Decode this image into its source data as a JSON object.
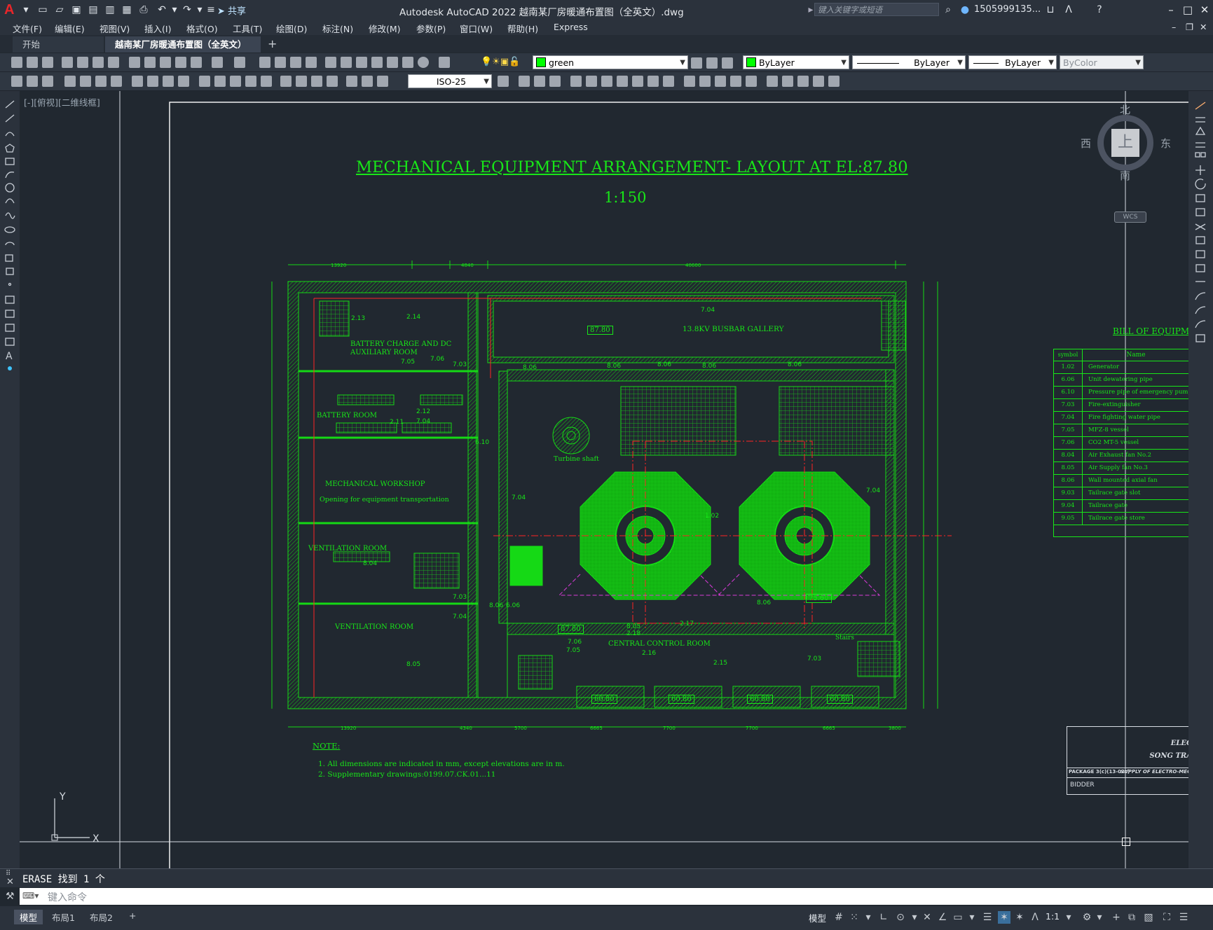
{
  "titlebar": {
    "app_logo": "A",
    "share": "共享",
    "title": "Autodesk AutoCAD 2022    越南某厂房暖通布置图（全英文）.dwg",
    "search_placeholder": "键入关键字或短语",
    "user": "1505999135..."
  },
  "menu": [
    "文件(F)",
    "编辑(E)",
    "视图(V)",
    "插入(I)",
    "格式(O)",
    "工具(T)",
    "绘图(D)",
    "标注(N)",
    "修改(M)",
    "参数(P)",
    "窗口(W)",
    "帮助(H)",
    "Express"
  ],
  "tabs": {
    "start": "开始",
    "drawing": "越南某厂房暖通布置图（全英文）*"
  },
  "toolbar": {
    "layer_name": "green",
    "color": "ByLayer",
    "linetype": "ByLayer",
    "lineweight": "ByLayer",
    "plotstyle": "ByColor",
    "dimstyle": "ISO-25",
    "layer_color": "#00ff00"
  },
  "viewport_label": "[-][俯视][二维线框]",
  "viewcube": {
    "north": "北",
    "south": "南",
    "east": "东",
    "west": "西",
    "top": "上",
    "wcs": "WCS"
  },
  "drawing": {
    "title": "MECHANICAL EQUIPMENT ARRANGEMENT- LAYOUT AT EL:87.80",
    "scale": "1:150",
    "rooms": {
      "busbar": "13.8KV BUSBAR GALLERY",
      "battery_charge": "BATTERY CHARGE AND DC",
      "aux_room": "AUXILIARY ROOM",
      "battery_room": "BATTERY ROOM",
      "workshop": "MECHANICAL WORKSHOP",
      "opening": "Opening for equipment transportation",
      "vent1": "VENTILATION ROOM",
      "vent2": "VENTILATION ROOM",
      "control": "CENTRAL CONTROL ROOM",
      "turbine": "Turbine shaft",
      "stairs": "Stairs"
    },
    "elevations": [
      "87.80",
      "87.80",
      "75.60",
      "60.80",
      "60.80",
      "60.80",
      "60.80"
    ],
    "dims_top": [
      "13920",
      "4840",
      "40600"
    ],
    "dims_bottom": [
      "13920",
      "4340",
      "5700",
      "6665",
      "7700",
      "7700",
      "6665",
      "3800"
    ],
    "labels": [
      "2.13",
      "2.14",
      "7.04",
      "7.05",
      "7.06",
      "7.03",
      "8.06",
      "8.06",
      "8.06",
      "8.06",
      "8.06",
      "2.12",
      "2.11",
      "7.04",
      "6.10",
      "7.04",
      "1.02",
      "7.04",
      "8.04",
      "7.03",
      "7.04",
      "8.05",
      "7.06",
      "7.05",
      "2.16",
      "2.15",
      "2.17",
      "7.03",
      "8.05",
      "2.18",
      "8.06",
      "8.06",
      "6.06"
    ],
    "note_title": "NOTE:",
    "notes": [
      "1. All dimensions are indicated in mm, except elevations are in m.",
      "2. Supplementary drawings:0199.07.CK.01...11"
    ]
  },
  "bill": {
    "title": "BILL OF EQUIPME",
    "headers": [
      "symbol",
      "Name"
    ],
    "rows": [
      [
        "1.02",
        "Generator"
      ],
      [
        "6.06",
        "Unit dewatering pipe"
      ],
      [
        "6.10",
        "Pressure pipe of emergency pump"
      ],
      [
        "7.03",
        "Fire-extinguisher"
      ],
      [
        "7.04",
        "Fire fighting water pipe"
      ],
      [
        "7.05",
        "MFZ-8 vessel"
      ],
      [
        "7.06",
        "CO2 MT-5 vessel"
      ],
      [
        "8.04",
        "Air Exhaust fan No.2"
      ],
      [
        "8.05",
        "Air Supply fan No.3"
      ],
      [
        "8.06",
        "Wall mounted axial fan"
      ],
      [
        "9.03",
        "Tailrace gate slot"
      ],
      [
        "9.04",
        "Tailrace gate"
      ],
      [
        "9.05",
        "Tailrace gate store"
      ]
    ]
  },
  "titleblock": {
    "line1": "ELEC",
    "line2": "SONG TRA",
    "package": "PACKAGE 3(c)(13-02c)",
    "supply": "SUPPLY OF ELECTRO-MEC",
    "bidder": "BIDDER"
  },
  "ucs": {
    "y": "Y",
    "x": "X"
  },
  "command": {
    "history": "ERASE 找到 1 个",
    "placeholder": "键入命令"
  },
  "layouts": [
    "模型",
    "布局1",
    "布局2"
  ],
  "status": {
    "model": "模型",
    "scale": "1:1"
  }
}
